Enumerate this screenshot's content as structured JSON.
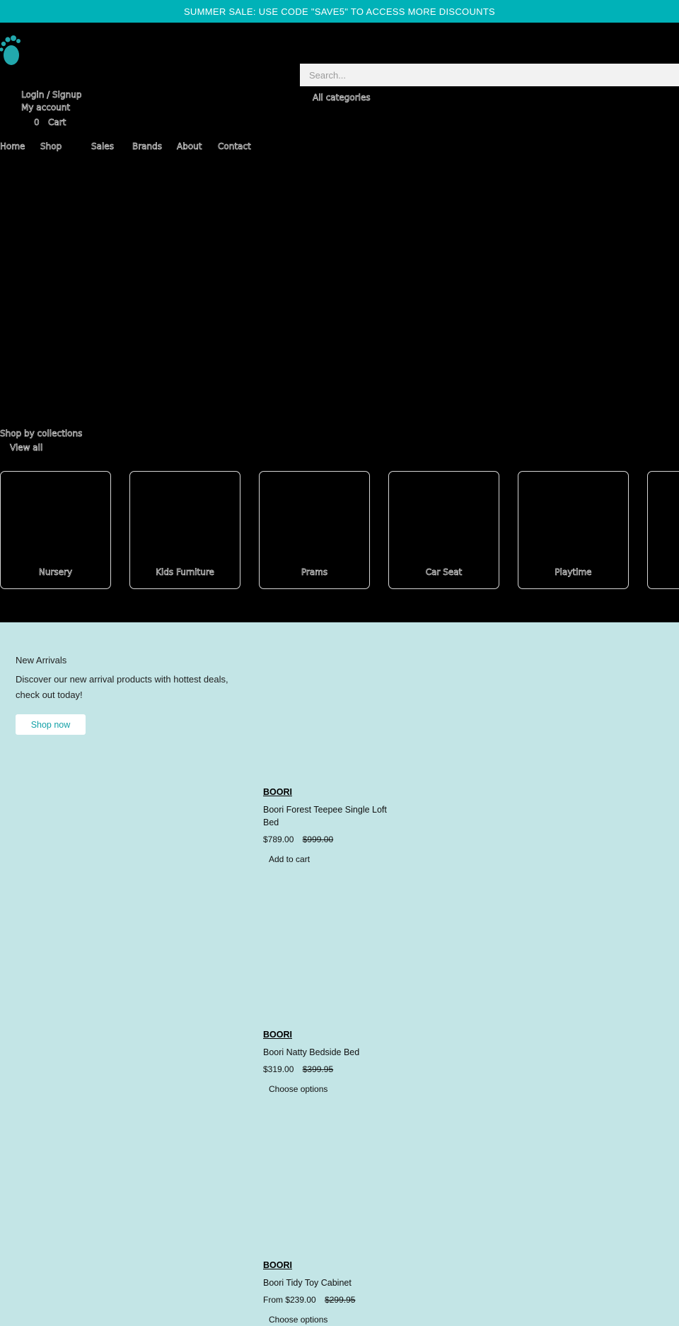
{
  "announcement": "SUMMER SALE: USE CODE \"SAVE5\" TO ACCESS MORE DISCOUNTS",
  "colors": {
    "accent": "#00b2b8",
    "header_bg": "#000000",
    "section_bg": "#c3e5e6",
    "logo": "#22a8ad"
  },
  "logo": {
    "icon": "baby-footprint-icon"
  },
  "search": {
    "placeholder": "Search...",
    "category_label": "All categories"
  },
  "account": {
    "login": "Login / Signup",
    "my_account": "My account"
  },
  "cart": {
    "count": "0",
    "label": "Cart"
  },
  "nav": [
    "Home",
    "Shop",
    "Sales",
    "Brands",
    "About",
    "Contact"
  ],
  "collections": {
    "title": "Shop by collections",
    "view_all": "View all",
    "items": [
      "Nursery",
      "Kids Furniture",
      "Prams",
      "Car Seat",
      "Playtime",
      ""
    ]
  },
  "arrivals": {
    "title": "New Arrivals",
    "description": "Discover our new arrival products with hottest deals, check out today!",
    "button": "Shop now",
    "products": [
      {
        "brand": "BOORI",
        "name": "Boori Forest Teepee Single Loft Bed",
        "price": "$789.00",
        "compare": "$999.00",
        "action": "Add to cart"
      },
      {
        "brand": "BOORI",
        "name": "Boori Natty Bedside Bed",
        "price": "$319.00",
        "compare": "$399.95",
        "action": "Choose options"
      },
      {
        "brand": "BOORI",
        "name": "Boori Tidy Toy Cabinet",
        "price": "From $239.00",
        "compare": "$299.95",
        "action": "Choose options"
      }
    ]
  }
}
